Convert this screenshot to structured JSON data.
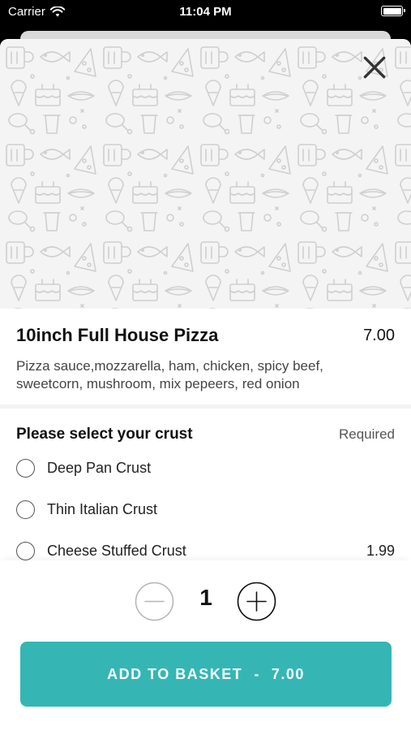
{
  "status_bar": {
    "carrier": "Carrier",
    "time": "11:04 PM"
  },
  "product": {
    "title": "10inch Full House Pizza",
    "price": "7.00",
    "description": "Pizza sauce,mozzarella, ham, chicken, spicy beef, sweetcorn, mushroom, mix pepeers, red onion"
  },
  "options": {
    "header": "Please select your crust",
    "required_label": "Required",
    "items": [
      {
        "label": "Deep Pan Crust",
        "price": ""
      },
      {
        "label": "Thin Italian Crust",
        "price": ""
      },
      {
        "label": "Cheese Stuffed Crust",
        "price": "1.99"
      }
    ]
  },
  "quantity": {
    "value": "1"
  },
  "basket_button": {
    "label": "ADD TO BASKET",
    "separator": "-",
    "total": "7.00"
  },
  "colors": {
    "accent": "#35b6b5",
    "hero_background": "#f4f4f4",
    "pattern_stroke": "#cfcfcf"
  },
  "icons": [
    "wifi-icon",
    "battery-icon",
    "close-icon",
    "minus-circle-icon",
    "plus-circle-icon",
    "food-doodle-pattern"
  ]
}
